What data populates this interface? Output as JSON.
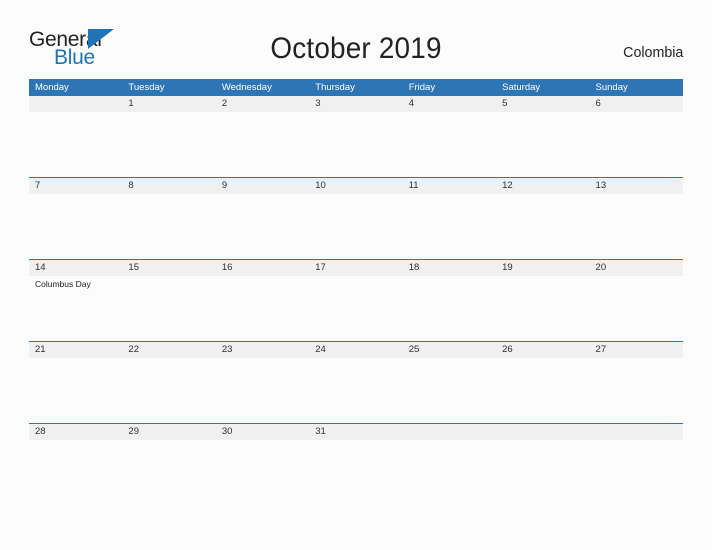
{
  "brand": {
    "logo_text_primary": "General",
    "logo_text_secondary": "Blue",
    "logo_triangle_color": "#2173b8"
  },
  "header": {
    "title": "October 2019",
    "country": "Colombia"
  },
  "colors": {
    "header_blue": "#2e75b6",
    "date_band_gray": "#f0f0f0",
    "page_background": "#fcfcfc",
    "text_dark": "#303030"
  },
  "calendar": {
    "month": "October",
    "year": "2019",
    "weekday_headers": [
      "Monday",
      "Tuesday",
      "Wednesday",
      "Thursday",
      "Friday",
      "Saturday",
      "Sunday"
    ],
    "weeks": [
      {
        "days": [
          {
            "date": "",
            "event": ""
          },
          {
            "date": "1",
            "event": ""
          },
          {
            "date": "2",
            "event": ""
          },
          {
            "date": "3",
            "event": ""
          },
          {
            "date": "4",
            "event": ""
          },
          {
            "date": "5",
            "event": ""
          },
          {
            "date": "6",
            "event": ""
          }
        ]
      },
      {
        "days": [
          {
            "date": "7",
            "event": ""
          },
          {
            "date": "8",
            "event": ""
          },
          {
            "date": "9",
            "event": ""
          },
          {
            "date": "10",
            "event": ""
          },
          {
            "date": "11",
            "event": ""
          },
          {
            "date": "12",
            "event": ""
          },
          {
            "date": "13",
            "event": ""
          }
        ]
      },
      {
        "days": [
          {
            "date": "14",
            "event": "Columbus Day"
          },
          {
            "date": "15",
            "event": ""
          },
          {
            "date": "16",
            "event": ""
          },
          {
            "date": "17",
            "event": ""
          },
          {
            "date": "18",
            "event": ""
          },
          {
            "date": "19",
            "event": ""
          },
          {
            "date": "20",
            "event": ""
          }
        ]
      },
      {
        "days": [
          {
            "date": "21",
            "event": ""
          },
          {
            "date": "22",
            "event": ""
          },
          {
            "date": "23",
            "event": ""
          },
          {
            "date": "24",
            "event": ""
          },
          {
            "date": "25",
            "event": ""
          },
          {
            "date": "26",
            "event": ""
          },
          {
            "date": "27",
            "event": ""
          }
        ]
      },
      {
        "days": [
          {
            "date": "28",
            "event": ""
          },
          {
            "date": "29",
            "event": ""
          },
          {
            "date": "30",
            "event": ""
          },
          {
            "date": "31",
            "event": ""
          },
          {
            "date": "",
            "event": ""
          },
          {
            "date": "",
            "event": ""
          },
          {
            "date": "",
            "event": ""
          }
        ]
      }
    ]
  }
}
